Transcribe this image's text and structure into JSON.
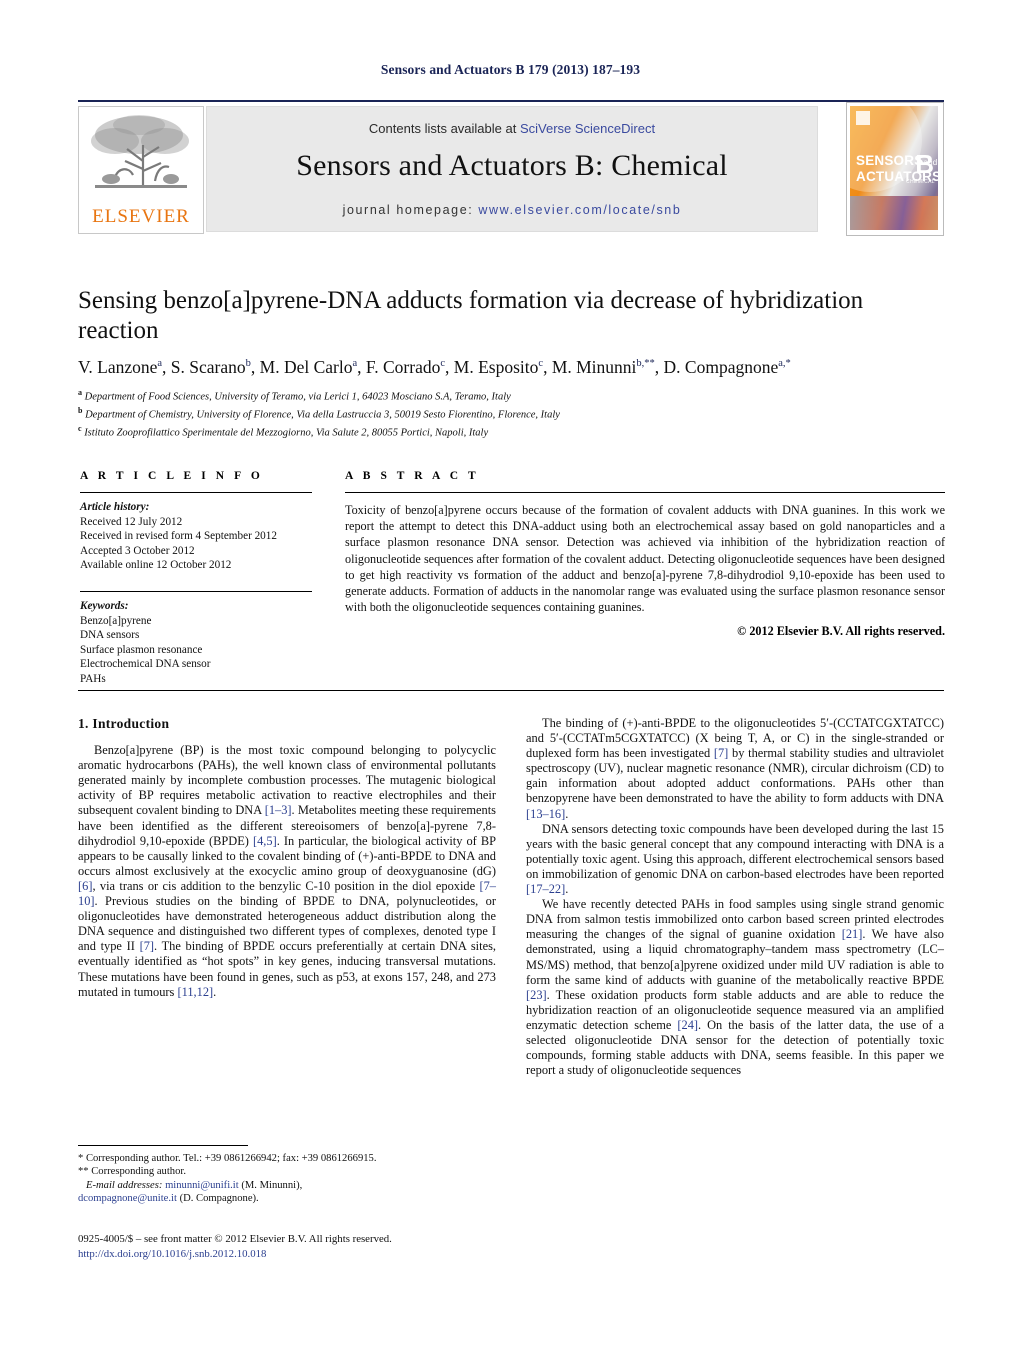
{
  "running_head": "Sensors and Actuators B 179 (2013) 187–193",
  "masthead": {
    "publisher_logo_label": "ELSEVIER",
    "contents_prefix": "Contents lists available at ",
    "contents_service": "SciVerse ScienceDirect",
    "journal_title": "Sensors and Actuators B: Chemical",
    "homepage_prefix": "journal homepage: ",
    "homepage_url": "www.elsevier.com/locate/snb",
    "cover": {
      "line1": "SENSORS",
      "line1_small": "and",
      "line2": "ACTUATORS",
      "letter": "B",
      "subtitle": "CHEMICAL"
    }
  },
  "article": {
    "title": "Sensing benzo[a]pyrene-DNA adducts formation via decrease of hybridization reaction",
    "authors": "V. Lanzone<sup>a</sup>, S. Scarano<sup>b</sup>, M. Del Carlo<sup>a</sup>, F. Corrado<sup>c</sup>, M. Esposito<sup>c</sup>, M. Minunni<sup>b,**</sup>, D. Compagnone<sup>a,*</sup>",
    "affiliations": [
      "<sup>a</sup> Department of Food Sciences, University of Teramo, via Lerici 1, 64023 Mosciano S.A, Teramo, Italy",
      "<sup>b</sup> Department of Chemistry, University of Florence, Via della Lastruccia 3, 50019 Sesto Fiorentino, Florence, Italy",
      "<sup>c</sup> Istituto Zooprofilattico Sperimentale del Mezzogiorno, Via Salute 2, 80055 Portici, Napoli, Italy"
    ]
  },
  "article_info": {
    "heading": "A R T I C L E    I N F O",
    "history_label": "Article history:",
    "history": [
      "Received 12 July 2012",
      "Received in revised form 4 September 2012",
      "Accepted 3 October 2012",
      "Available online 12 October 2012"
    ],
    "keywords_label": "Keywords:",
    "keywords": [
      "Benzo[a]pyrene",
      "DNA sensors",
      "Surface plasmon resonance",
      "Electrochemical DNA sensor",
      "PAHs"
    ]
  },
  "abstract": {
    "heading": "A B S T R A C T",
    "text": "Toxicity of benzo[a]pyrene occurs because of the formation of covalent adducts with DNA guanines. In this work we report the attempt to detect this DNA-adduct using both an electrochemical assay based on gold nanoparticles and a surface plasmon resonance DNA sensor. Detection was achieved via inhibition of the hybridization reaction of oligonucleotide sequences after formation of the covalent adduct. Detecting oligonucleotide sequences have been designed to get high reactivity vs formation of the adduct and benzo[a]-pyrene 7,8-dihydrodiol 9,10-epoxide has been used to generate adducts. Formation of adducts in the nanomolar range was evaluated using the surface plasmon resonance sensor with both the oligonucleotide sequences containing guanines.",
    "copyright": "© 2012 Elsevier B.V. All rights reserved."
  },
  "body": {
    "section_heading": "1. Introduction",
    "left_paragraphs": [
      "Benzo[a]pyrene (BP) is the most toxic compound belonging to polycyclic aromatic hydrocarbons (PAHs), the well known class of environmental pollutants generated mainly by incomplete combustion processes. The mutagenic biological activity of BP requires metabolic activation to reactive electrophiles and their subsequent covalent binding to DNA <span class=\"ref\">[1–3]</span>. Metabolites meeting these requirements have been identified as the different stereoisomers of benzo[a]-pyrene 7,8-dihydrodiol 9,10-epoxide (BPDE) <span class=\"ref\">[4,5]</span>. In particular, the biological activity of BP appears to be causally linked to the covalent binding of (+)-anti-BPDE to DNA and occurs almost exclusively at the exocyclic amino group of deoxyguanosine (dG) <span class=\"ref\">[6]</span>, via trans or cis addition to the benzylic C-10 position in the diol epoxide <span class=\"ref\">[7–10]</span>. Previous studies on the binding of BPDE to DNA, polynucleotides, or oligonucleotides have demonstrated heterogeneous adduct distribution along the DNA sequence and distinguished two different types of complexes, denoted type I and type II <span class=\"ref\">[7]</span>. The binding of BPDE occurs preferentially at certain DNA sites, eventually identified as “hot spots” in key genes, inducing transversal mutations. These mutations have been found in genes, such as p53, at exons 157, 248, and 273 mutated in tumours <span class=\"ref\">[11,12]</span>."
    ],
    "right_paragraphs": [
      "The binding of (+)-anti-BPDE to the oligonucleotides 5′-(CCTATCGXTATCC) and 5′-(CCTATm5CGXTATCC) (X being T, A, or C) in the single-stranded or duplexed form has been investigated <span class=\"ref\">[7]</span> by thermal stability studies and ultraviolet spectroscopy (UV), nuclear magnetic resonance (NMR), circular dichroism (CD) to gain information about adopted adduct conformations. PAHs other than benzopyrene have been demonstrated to have the ability to form adducts with DNA <span class=\"ref\">[13–16]</span>.",
      "DNA sensors detecting toxic compounds have been developed during the last 15 years with the basic general concept that any compound interacting with DNA is a potentially toxic agent. Using this approach, different electrochemical sensors based on immobilization of genomic DNA on carbon-based electrodes have been reported <span class=\"ref\">[17–22]</span>.",
      "We have recently detected PAHs in food samples using single strand genomic DNA from salmon testis immobilized onto carbon based screen printed electrodes measuring the changes of the signal of guanine oxidation <span class=\"ref\">[21]</span>. We have also demonstrated, using a liquid chromatography–tandem mass spectrometry (LC–MS/MS) method, that benzo[a]pyrene oxidized under mild UV radiation is able to form the same kind of adducts with guanine of the metabolically reactive BPDE <span class=\"ref\">[23]</span>. These oxidation products form stable adducts and are able to reduce the hybridization reaction of an oligonucleotide sequence measured via an amplified enzymatic detection scheme <span class=\"ref\">[24]</span>. On the basis of the latter data, the use of a selected oligonucleotide DNA sensor for the detection of potentially toxic compounds, forming stable adducts with DNA, seems feasible. In this paper we report a study of oligonucleotide sequences"
    ]
  },
  "footnotes": {
    "corresponding_1": "* Corresponding author. Tel.: +39 0861266942; fax: +39 0861266915.",
    "corresponding_2": "** Corresponding author.",
    "email_label": "E-mail addresses:",
    "email_1": "minunni@unifi.it",
    "email_1_owner": "(M. Minunni),",
    "email_2": "dcompagnone@unite.it",
    "email_2_owner": "(D. Compagnone)."
  },
  "imprint": {
    "line1": "0925-4005/$ – see front matter © 2012 Elsevier B.V. All rights reserved.",
    "doi": "http://dx.doi.org/10.1016/j.snb.2012.10.018"
  }
}
